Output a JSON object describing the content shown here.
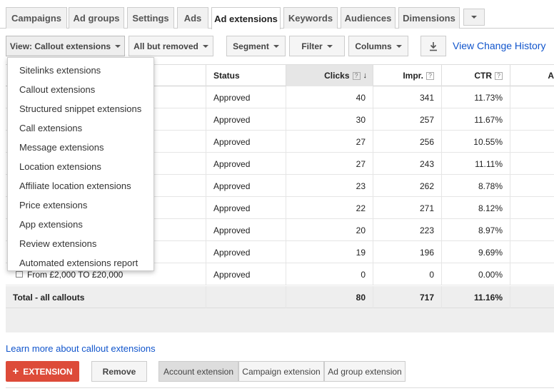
{
  "tabs": [
    {
      "label": "Campaigns"
    },
    {
      "label": "Ad groups"
    },
    {
      "label": "Settings"
    },
    {
      "label": "Ads"
    },
    {
      "label": "Ad extensions",
      "active": true
    },
    {
      "label": "Keywords"
    },
    {
      "label": "Audiences"
    },
    {
      "label": "Dimensions"
    }
  ],
  "toolbar": {
    "view_label": "View: Callout extensions",
    "filter_status_label": "All but removed",
    "segment_label": "Segment",
    "filter_label": "Filter",
    "columns_label": "Columns",
    "history_link": "View Change History"
  },
  "dropdown": {
    "items": [
      "Sitelinks extensions",
      "Callout extensions",
      "Structured snippet extensions",
      "Call extensions",
      "Message extensions",
      "Location extensions",
      "Affiliate location extensions",
      "Price extensions",
      "App extensions",
      "Review extensions",
      "Automated extensions report"
    ]
  },
  "table": {
    "headers": {
      "status": "Status",
      "clicks": "Clicks",
      "impr": "Impr.",
      "ctr": "CTR",
      "more": "A"
    },
    "rows": [
      {
        "name": "",
        "status": "Approved",
        "clicks": "40",
        "impr": "341",
        "ctr": "11.73%"
      },
      {
        "name": "",
        "status": "Approved",
        "clicks": "30",
        "impr": "257",
        "ctr": "11.67%"
      },
      {
        "name": "",
        "status": "Approved",
        "clicks": "27",
        "impr": "256",
        "ctr": "10.55%"
      },
      {
        "name": "",
        "status": "Approved",
        "clicks": "27",
        "impr": "243",
        "ctr": "11.11%"
      },
      {
        "name": "",
        "status": "Approved",
        "clicks": "23",
        "impr": "262",
        "ctr": "8.78%"
      },
      {
        "name": "",
        "status": "Approved",
        "clicks": "22",
        "impr": "271",
        "ctr": "8.12%"
      },
      {
        "name": "",
        "status": "Approved",
        "clicks": "20",
        "impr": "223",
        "ctr": "8.97%"
      },
      {
        "name": "",
        "status": "Approved",
        "clicks": "19",
        "impr": "196",
        "ctr": "9.69%"
      },
      {
        "name": "From £2,000 TO £20,000",
        "status": "Approved",
        "clicks": "0",
        "impr": "0",
        "ctr": "0.00%"
      }
    ],
    "total": {
      "label": "Total - all callouts",
      "clicks": "80",
      "impr": "717",
      "ctr": "11.16%"
    }
  },
  "footer": {
    "learn_link": "Learn more about callout extensions",
    "add_label": "EXTENSION",
    "remove_label": "Remove",
    "segments": [
      "Account extension",
      "Campaign extension",
      "Ad group extension"
    ]
  },
  "colors": {
    "accent_red": "#dd4b39",
    "link_blue": "#1155cc"
  }
}
